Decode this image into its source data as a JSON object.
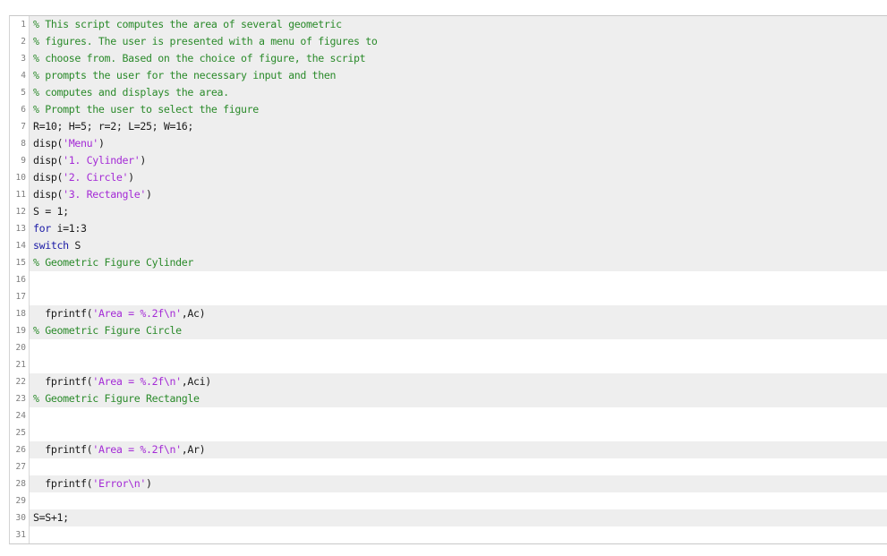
{
  "editor": {
    "colors": {
      "comment": "#2a8a2a",
      "string": "#a42ad6",
      "keyword": "#1a1aa6",
      "plain": "#1a1a1a",
      "highlight_row": "#eeeeee"
    },
    "lines": [
      {
        "n": "1",
        "hl": true,
        "tokens": [
          {
            "t": "comment",
            "v": "% This script computes the area of several geometric"
          }
        ]
      },
      {
        "n": "2",
        "hl": true,
        "tokens": [
          {
            "t": "comment",
            "v": "% figures. The user is presented with a menu of figures to"
          }
        ]
      },
      {
        "n": "3",
        "hl": true,
        "tokens": [
          {
            "t": "comment",
            "v": "% choose from. Based on the choice of figure, the script"
          }
        ]
      },
      {
        "n": "4",
        "hl": true,
        "tokens": [
          {
            "t": "comment",
            "v": "% prompts the user for the necessary input and then"
          }
        ]
      },
      {
        "n": "5",
        "hl": true,
        "tokens": [
          {
            "t": "comment",
            "v": "% computes and displays the area."
          }
        ]
      },
      {
        "n": "6",
        "hl": true,
        "tokens": [
          {
            "t": "comment",
            "v": "% Prompt the user to select the figure"
          }
        ]
      },
      {
        "n": "7",
        "hl": true,
        "tokens": [
          {
            "t": "plain",
            "v": "R=10; H=5; r=2; L=25; W=16;"
          }
        ]
      },
      {
        "n": "8",
        "hl": true,
        "tokens": [
          {
            "t": "plain",
            "v": "disp("
          },
          {
            "t": "string",
            "v": "'Menu'"
          },
          {
            "t": "plain",
            "v": ")"
          }
        ]
      },
      {
        "n": "9",
        "hl": true,
        "tokens": [
          {
            "t": "plain",
            "v": "disp("
          },
          {
            "t": "string",
            "v": "'1. Cylinder'"
          },
          {
            "t": "plain",
            "v": ")"
          }
        ]
      },
      {
        "n": "10",
        "hl": true,
        "tokens": [
          {
            "t": "plain",
            "v": "disp("
          },
          {
            "t": "string",
            "v": "'2. Circle'"
          },
          {
            "t": "plain",
            "v": ")"
          }
        ]
      },
      {
        "n": "11",
        "hl": true,
        "tokens": [
          {
            "t": "plain",
            "v": "disp("
          },
          {
            "t": "string",
            "v": "'3. Rectangle'"
          },
          {
            "t": "plain",
            "v": ")"
          }
        ]
      },
      {
        "n": "12",
        "hl": true,
        "tokens": [
          {
            "t": "plain",
            "v": "S = 1;"
          }
        ]
      },
      {
        "n": "13",
        "hl": true,
        "tokens": [
          {
            "t": "keyword",
            "v": "for"
          },
          {
            "t": "plain",
            "v": " i=1:3"
          }
        ]
      },
      {
        "n": "14",
        "hl": true,
        "tokens": [
          {
            "t": "keyword",
            "v": "switch"
          },
          {
            "t": "plain",
            "v": " S"
          }
        ]
      },
      {
        "n": "15",
        "hl": true,
        "tokens": [
          {
            "t": "comment",
            "v": "% Geometric Figure Cylinder"
          }
        ]
      },
      {
        "n": "16",
        "hl": false,
        "tokens": []
      },
      {
        "n": "17",
        "hl": false,
        "tokens": []
      },
      {
        "n": "18",
        "hl": true,
        "tokens": [
          {
            "t": "plain",
            "v": "  fprintf("
          },
          {
            "t": "string",
            "v": "'Area = %.2f\\n'"
          },
          {
            "t": "plain",
            "v": ",Ac)"
          }
        ]
      },
      {
        "n": "19",
        "hl": true,
        "tokens": [
          {
            "t": "comment",
            "v": "% Geometric Figure Circle"
          }
        ]
      },
      {
        "n": "20",
        "hl": false,
        "tokens": []
      },
      {
        "n": "21",
        "hl": false,
        "tokens": []
      },
      {
        "n": "22",
        "hl": true,
        "tokens": [
          {
            "t": "plain",
            "v": "  fprintf("
          },
          {
            "t": "string",
            "v": "'Area = %.2f\\n'"
          },
          {
            "t": "plain",
            "v": ",Aci)"
          }
        ]
      },
      {
        "n": "23",
        "hl": true,
        "tokens": [
          {
            "t": "comment",
            "v": "% Geometric Figure Rectangle"
          }
        ]
      },
      {
        "n": "24",
        "hl": false,
        "tokens": []
      },
      {
        "n": "25",
        "hl": false,
        "tokens": []
      },
      {
        "n": "26",
        "hl": true,
        "tokens": [
          {
            "t": "plain",
            "v": "  fprintf("
          },
          {
            "t": "string",
            "v": "'Area = %.2f\\n'"
          },
          {
            "t": "plain",
            "v": ",Ar)"
          }
        ]
      },
      {
        "n": "27",
        "hl": false,
        "tokens": []
      },
      {
        "n": "28",
        "hl": true,
        "tokens": [
          {
            "t": "plain",
            "v": "  fprintf("
          },
          {
            "t": "string",
            "v": "'Error\\n'"
          },
          {
            "t": "plain",
            "v": ")"
          }
        ]
      },
      {
        "n": "29",
        "hl": false,
        "tokens": []
      },
      {
        "n": "30",
        "hl": true,
        "tokens": [
          {
            "t": "plain",
            "v": "S=S+1;"
          }
        ]
      },
      {
        "n": "31",
        "hl": false,
        "tokens": []
      }
    ]
  }
}
